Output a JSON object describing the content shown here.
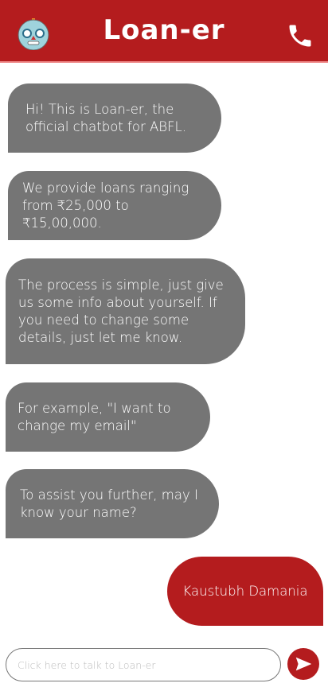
{
  "header": {
    "title": "Loan-er",
    "bot_icon": "robot-icon",
    "call_icon": "phone-icon"
  },
  "messages": [
    {
      "sender": "bot",
      "text": "Hi! This is Loan-er, the official chatbot for ABFL."
    },
    {
      "sender": "bot",
      "text": "We provide loans ranging from ₹25,000 to ₹15,00,000."
    },
    {
      "sender": "bot",
      "text": "The process is simple, just give us some info about yourself. If you need to change some details, just let me know."
    },
    {
      "sender": "bot",
      "text": "For example, \"I want to change my email\""
    },
    {
      "sender": "bot",
      "text": "To assist you further, may I know your name?"
    },
    {
      "sender": "user",
      "text": "Kaustubh Damania"
    }
  ],
  "composer": {
    "placeholder": "Click here to talk to Loan-er",
    "send_icon": "send-icon"
  },
  "colors": {
    "brand": "#b41c1e",
    "bot_bubble": "#757575"
  }
}
